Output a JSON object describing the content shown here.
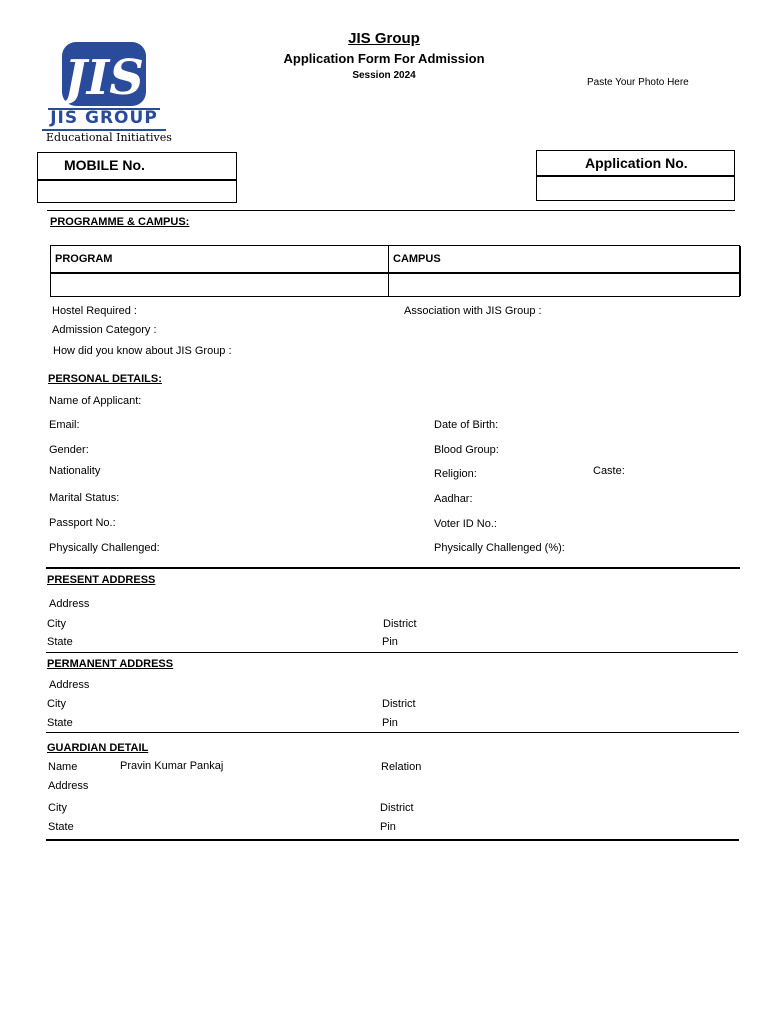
{
  "header": {
    "title": "JIS Group",
    "subtitle": "Application Form For Admission",
    "session": "Session 2024",
    "photo_placeholder": "Paste Your Photo Here"
  },
  "logo": {
    "letters": "JIS",
    "name": "JIS GROUP",
    "tagline": "Educational Initiatives",
    "brand_color": "#2a4a9a"
  },
  "mobile_box": {
    "label": "MOBILE No.",
    "value": ""
  },
  "application_box": {
    "label": "Application No.",
    "value": ""
  },
  "programme": {
    "heading": "PROGRAMME & CAMPUS:",
    "program_header": "PROGRAM",
    "campus_header": "CAMPUS",
    "program_value": "",
    "campus_value": "",
    "hostel_label": "Hostel Required :",
    "association_label": "Association with JIS Group :",
    "category_label": "Admission Category :",
    "source_label": "How did you know about JIS Group :"
  },
  "personal": {
    "heading": "PERSONAL DETAILS:",
    "name_label": "Name of Applicant:",
    "email_label": "Email:",
    "dob_label": "Date of Birth:",
    "gender_label": "Gender:",
    "blood_label": "Blood Group:",
    "nationality_label": "Nationality",
    "religion_label": "Religion:",
    "caste_label": "Caste:",
    "marital_label": "Marital Status:",
    "aadhar_label": "Aadhar:",
    "passport_label": "Passport No.:",
    "voter_label": "Voter ID No.:",
    "challenged_label": "Physically Challenged:",
    "challenged_pct_label": "Physically Challenged (%):"
  },
  "present_address": {
    "heading": "PRESENT ADDRESS",
    "address_label": "Address",
    "city_label": "City",
    "district_label": "District",
    "state_label": "State",
    "pin_label": "Pin"
  },
  "permanent_address": {
    "heading": "PERMANENT ADDRESS",
    "address_label": "Address",
    "city_label": "City",
    "district_label": "District",
    "state_label": "State",
    "pin_label": "Pin"
  },
  "guardian": {
    "heading": "GUARDIAN DETAIL",
    "name_label": "Name",
    "name_value": "Pravin Kumar Pankaj",
    "relation_label": "Relation",
    "address_label": "Address",
    "city_label": "City",
    "district_label": "District",
    "state_label": "State",
    "pin_label": "Pin"
  }
}
